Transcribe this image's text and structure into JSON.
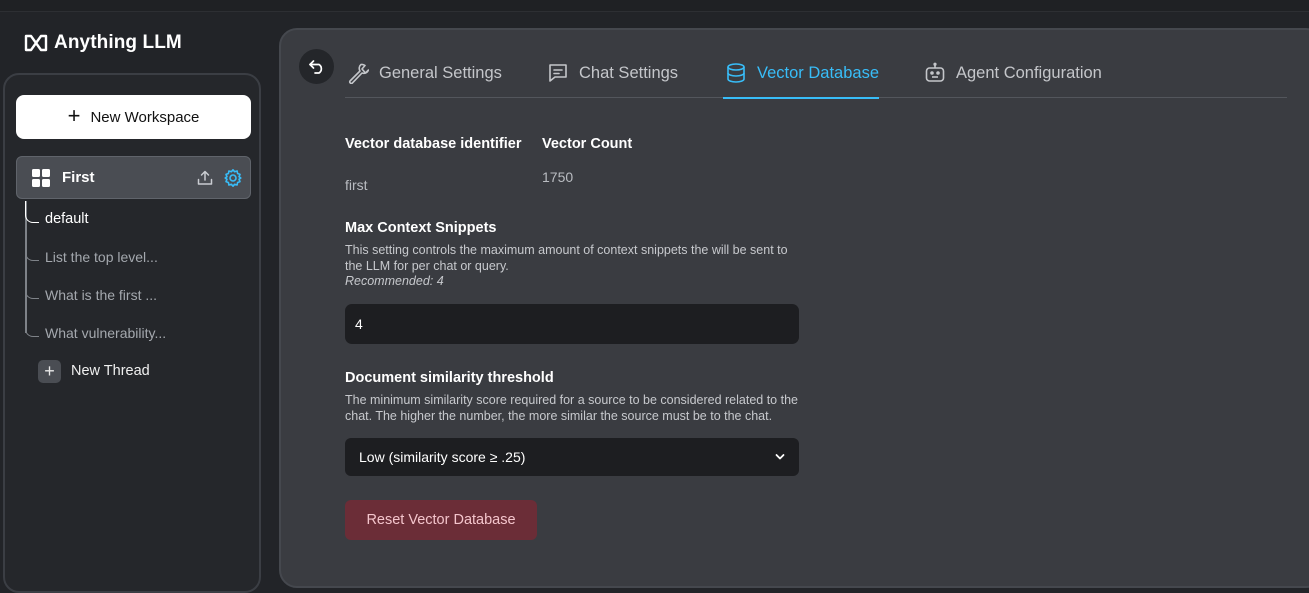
{
  "app": {
    "logo_text": "Anything LLM"
  },
  "sidebar": {
    "new_workspace_label": "New Workspace",
    "workspace": {
      "name": "First"
    },
    "threads": [
      {
        "label": "default",
        "active": true
      },
      {
        "label": "List the top level...",
        "active": false
      },
      {
        "label": "What is the first ...",
        "active": false
      },
      {
        "label": "What vulnerability...",
        "active": false
      }
    ],
    "new_thread_label": "New Thread"
  },
  "tabs": [
    {
      "label": "General Settings",
      "icon": "wrench-icon",
      "active": false
    },
    {
      "label": "Chat Settings",
      "icon": "chat-icon",
      "active": false
    },
    {
      "label": "Vector Database",
      "icon": "database-icon",
      "active": true
    },
    {
      "label": "Agent Configuration",
      "icon": "robot-icon",
      "active": false
    }
  ],
  "vector": {
    "identifier_label": "Vector database identifier",
    "identifier_value": "first",
    "count_label": "Vector Count",
    "count_value": "1750"
  },
  "snippets": {
    "label": "Max Context Snippets",
    "description": "This setting controls the maximum amount of context snippets the will be sent to the LLM for per chat or query.",
    "recommended": "Recommended: 4",
    "value": "4"
  },
  "similarity": {
    "label": "Document similarity threshold",
    "description": "The minimum similarity score required for a source to be considered related to the chat. The higher the number, the more similar the source must be to the chat.",
    "selected": "Low (similarity score ≥ .25)"
  },
  "reset_button_label": "Reset Vector Database",
  "colors": {
    "accent": "#38bdf8",
    "danger_bg": "#6b2d37",
    "danger_text": "#f4c5cc"
  }
}
